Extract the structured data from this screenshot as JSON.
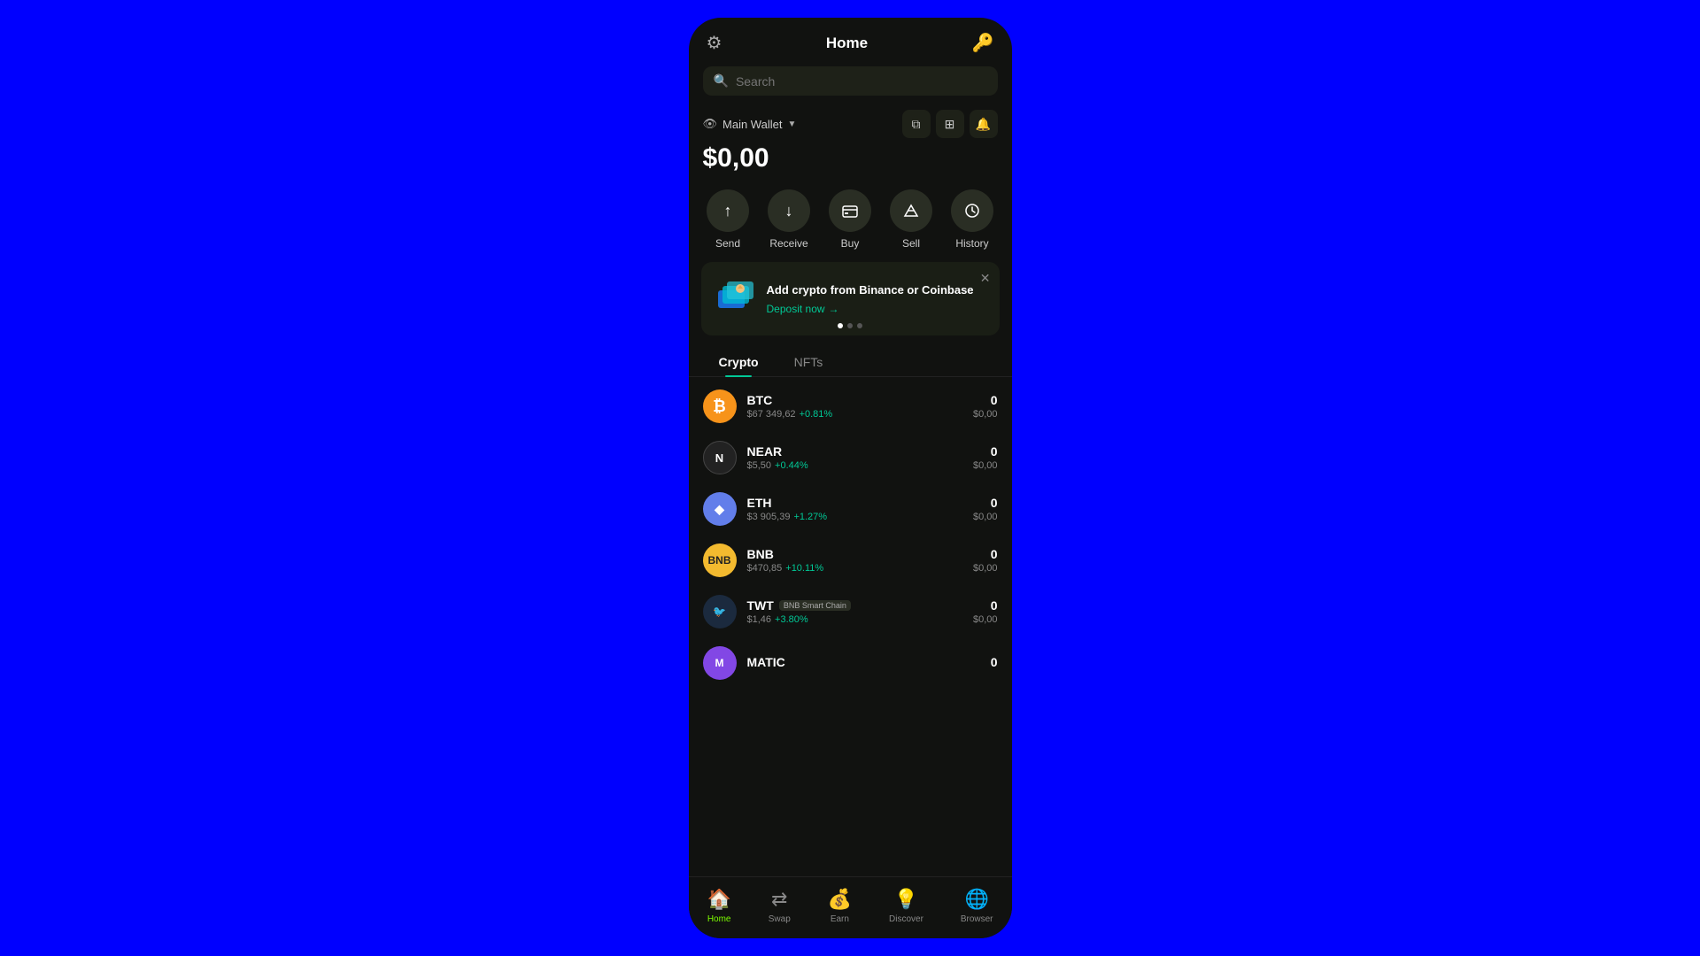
{
  "header": {
    "title": "Home",
    "settings_icon": "⚙",
    "key_icon": "🔑"
  },
  "search": {
    "placeholder": "Search"
  },
  "wallet": {
    "label": "Main Wallet",
    "balance": "$0,00",
    "actions": [
      {
        "icon": "⧉",
        "name": "copy"
      },
      {
        "icon": "⊞",
        "name": "grid"
      },
      {
        "icon": "🔔",
        "name": "notifications"
      }
    ]
  },
  "action_buttons": [
    {
      "id": "send",
      "label": "Send",
      "icon": "↑"
    },
    {
      "id": "receive",
      "label": "Receive",
      "icon": "↓"
    },
    {
      "id": "buy",
      "label": "Buy",
      "icon": "🏦"
    },
    {
      "id": "sell",
      "label": "Sell",
      "icon": "🏛"
    },
    {
      "id": "history",
      "label": "History",
      "icon": "🕐"
    }
  ],
  "promo": {
    "title": "Add crypto from Binance or Coinbase",
    "link": "Deposit now",
    "dots": [
      true,
      false,
      false
    ]
  },
  "tabs": [
    {
      "id": "crypto",
      "label": "Crypto",
      "active": true
    },
    {
      "id": "nfts",
      "label": "NFTs",
      "active": false
    }
  ],
  "crypto_list": [
    {
      "id": "btc",
      "symbol": "BTC",
      "price": "$67 349,62",
      "change": "+0.81%",
      "change_type": "positive",
      "balance": "0",
      "balance_usd": "$0,00",
      "chain_badge": ""
    },
    {
      "id": "near",
      "symbol": "NEAR",
      "price": "$5,50",
      "change": "+0.44%",
      "change_type": "positive",
      "balance": "0",
      "balance_usd": "$0,00",
      "chain_badge": ""
    },
    {
      "id": "eth",
      "symbol": "ETH",
      "price": "$3 905,39",
      "change": "+1.27%",
      "change_type": "positive",
      "balance": "0",
      "balance_usd": "$0,00",
      "chain_badge": ""
    },
    {
      "id": "bnb",
      "symbol": "BNB",
      "price": "$470,85",
      "change": "+10.11%",
      "change_type": "positive",
      "balance": "0",
      "balance_usd": "$0,00",
      "chain_badge": ""
    },
    {
      "id": "twt",
      "symbol": "TWT",
      "price": "$1,46",
      "change": "+3.80%",
      "change_type": "positive",
      "balance": "0",
      "balance_usd": "$0,00",
      "chain_badge": "BNB Smart Chain"
    },
    {
      "id": "matic",
      "symbol": "MATIC",
      "price": "",
      "change": "",
      "change_type": "",
      "balance": "0",
      "balance_usd": "",
      "chain_badge": ""
    }
  ],
  "bottom_nav": [
    {
      "id": "home",
      "label": "Home",
      "icon": "🏠",
      "active": true
    },
    {
      "id": "swap",
      "label": "Swap",
      "icon": "⇄",
      "active": false
    },
    {
      "id": "earn",
      "label": "Earn",
      "icon": "💰",
      "active": false
    },
    {
      "id": "discover",
      "label": "Discover",
      "icon": "💡",
      "active": false
    },
    {
      "id": "browser",
      "label": "Browser",
      "icon": "🌐",
      "active": false
    }
  ]
}
